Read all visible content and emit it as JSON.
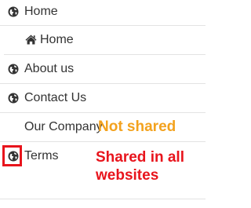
{
  "menu": {
    "items": [
      {
        "label": "Home",
        "icon": "globe-icon"
      },
      {
        "label": "Home",
        "icon": "home-icon"
      },
      {
        "label": "About us",
        "icon": "globe-icon"
      },
      {
        "label": "Contact Us",
        "icon": "globe-icon"
      },
      {
        "label": "Our Company",
        "icon": ""
      },
      {
        "label": "Terms",
        "icon": "globe-icon"
      }
    ]
  },
  "annotations": {
    "not_shared": "Not shared",
    "shared_line1": "Shared in all",
    "shared_line2": "websites"
  },
  "colors": {
    "text": "#333333",
    "separator": "#e3e3e3",
    "annotation_orange": "#f3a21e",
    "annotation_red": "#e8141c"
  }
}
